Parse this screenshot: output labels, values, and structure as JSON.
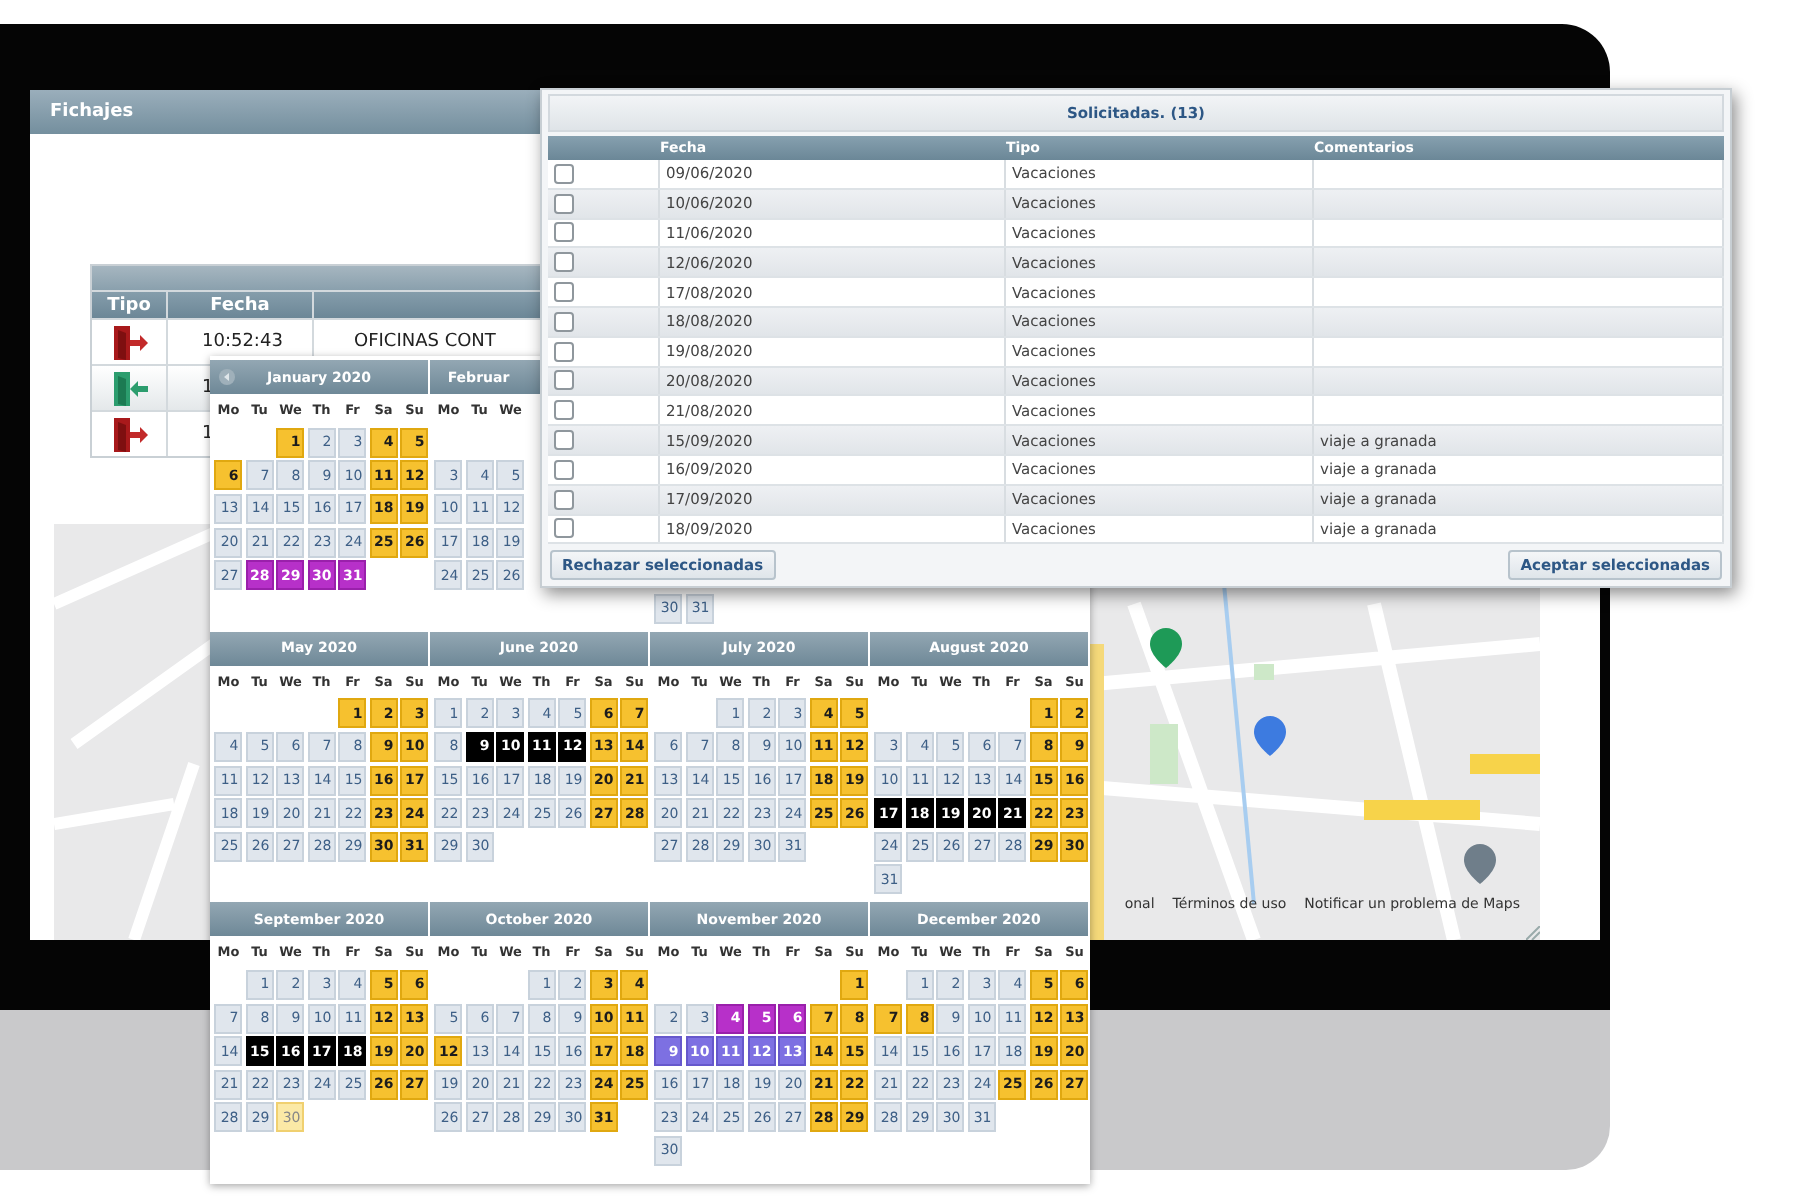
{
  "fichajes": {
    "title": "Fichajes",
    "punches": {
      "columns": [
        "Tipo",
        "Fecha"
      ],
      "rows": [
        {
          "kind": "exit",
          "time": "10:52:43",
          "place": "OFICINAS CONT"
        },
        {
          "kind": "entry",
          "time": "1"
        },
        {
          "kind": "exit",
          "time": "1"
        }
      ]
    },
    "map": {
      "footer": [
        "onal",
        "Términos de uso",
        "Notificar un problema de Maps"
      ]
    }
  },
  "calendar": {
    "rows": [
      {
        "months": [
          {
            "title": "January 2020",
            "nav": true,
            "weekdays": [
              "Mo",
              "Tu",
              "We",
              "Th",
              "Fr",
              "Sa",
              "Su"
            ],
            "weeks": [
              [
                {
                  "kind": "blank"
                },
                {
                  "kind": "blank"
                },
                {
                  "day": "1",
                  "kind": "holiday"
                },
                {
                  "day": "2",
                  "kind": "work"
                },
                {
                  "day": "3",
                  "kind": "work"
                },
                {
                  "day": "4",
                  "kind": "holiday"
                },
                {
                  "day": "5",
                  "kind": "holiday"
                }
              ],
              [
                {
                  "day": "6",
                  "kind": "holiday"
                },
                {
                  "day": "7",
                  "kind": "work"
                },
                {
                  "day": "8",
                  "kind": "work"
                },
                {
                  "day": "9",
                  "kind": "work"
                },
                {
                  "day": "10",
                  "kind": "work"
                },
                {
                  "day": "11",
                  "kind": "holiday"
                },
                {
                  "day": "12",
                  "kind": "holiday"
                }
              ],
              [
                {
                  "day": "13",
                  "kind": "work"
                },
                {
                  "day": "14",
                  "kind": "work"
                },
                {
                  "day": "15",
                  "kind": "work"
                },
                {
                  "day": "16",
                  "kind": "work"
                },
                {
                  "day": "17",
                  "kind": "work"
                },
                {
                  "day": "18",
                  "kind": "holiday"
                },
                {
                  "day": "19",
                  "kind": "holiday"
                }
              ],
              [
                {
                  "day": "20",
                  "kind": "work"
                },
                {
                  "day": "21",
                  "kind": "work"
                },
                {
                  "day": "22",
                  "kind": "work"
                },
                {
                  "day": "23",
                  "kind": "work"
                },
                {
                  "day": "24",
                  "kind": "work"
                },
                {
                  "day": "25",
                  "kind": "holiday"
                },
                {
                  "day": "26",
                  "kind": "holiday"
                }
              ],
              [
                {
                  "day": "27",
                  "kind": "work"
                },
                {
                  "day": "28",
                  "kind": "taken"
                },
                {
                  "day": "29",
                  "kind": "taken"
                },
                {
                  "day": "30",
                  "kind": "taken"
                },
                {
                  "day": "31",
                  "kind": "taken"
                }
              ]
            ]
          },
          {
            "title": "Februar",
            "nav": false,
            "weekdays": [
              "Mo",
              "Tu",
              "We"
            ],
            "weeks": [
              [
                {
                  "kind": "blank"
                }
              ],
              [
                {
                  "day": "3",
                  "kind": "work"
                },
                {
                  "day": "4",
                  "kind": "work"
                },
                {
                  "day": "5",
                  "kind": "work"
                }
              ],
              [
                {
                  "day": "10",
                  "kind": "work"
                },
                {
                  "day": "11",
                  "kind": "work"
                },
                {
                  "day": "12",
                  "kind": "work"
                }
              ],
              [
                {
                  "day": "17",
                  "kind": "work"
                },
                {
                  "day": "18",
                  "kind": "work"
                },
                {
                  "day": "19",
                  "kind": "work"
                }
              ],
              [
                {
                  "day": "24",
                  "kind": "work"
                },
                {
                  "day": "25",
                  "kind": "work"
                },
                {
                  "day": "26",
                  "kind": "work"
                }
              ]
            ]
          },
          {
            "weeks": [
              [
                {
                  "kind": "blank"
                }
              ],
              [
                {
                  "kind": "blank"
                }
              ],
              [
                {
                  "kind": "blank"
                }
              ],
              [
                {
                  "kind": "blank"
                }
              ],
              [
                {
                  "kind": "blank"
                }
              ],
              [
                {
                  "day": "30",
                  "kind": "work"
                },
                {
                  "day": "31",
                  "kind": "work"
                }
              ]
            ]
          }
        ]
      },
      {
        "months": [
          {
            "title": "May 2020",
            "nav": false,
            "weekdays": [
              "Mo",
              "Tu",
              "We",
              "Th",
              "Fr",
              "Sa",
              "Su"
            ],
            "weeks": [
              [
                {
                  "kind": "blank"
                },
                {
                  "kind": "blank"
                },
                {
                  "kind": "blank"
                },
                {
                  "kind": "blank"
                },
                {
                  "day": "1",
                  "kind": "holiday"
                },
                {
                  "day": "2",
                  "kind": "holiday"
                },
                {
                  "day": "3",
                  "kind": "holiday"
                }
              ],
              [
                {
                  "day": "4",
                  "kind": "work"
                },
                {
                  "day": "5",
                  "kind": "work"
                },
                {
                  "day": "6",
                  "kind": "work"
                },
                {
                  "day": "7",
                  "kind": "work"
                },
                {
                  "day": "8",
                  "kind": "work"
                },
                {
                  "day": "9",
                  "kind": "holiday"
                },
                {
                  "day": "10",
                  "kind": "holiday"
                }
              ],
              [
                {
                  "day": "11",
                  "kind": "work"
                },
                {
                  "day": "12",
                  "kind": "work"
                },
                {
                  "day": "13",
                  "kind": "work"
                },
                {
                  "day": "14",
                  "kind": "work"
                },
                {
                  "day": "15",
                  "kind": "work"
                },
                {
                  "day": "16",
                  "kind": "holiday"
                },
                {
                  "day": "17",
                  "kind": "holiday"
                }
              ],
              [
                {
                  "day": "18",
                  "kind": "work"
                },
                {
                  "day": "19",
                  "kind": "work"
                },
                {
                  "day": "20",
                  "kind": "work"
                },
                {
                  "day": "21",
                  "kind": "work"
                },
                {
                  "day": "22",
                  "kind": "work"
                },
                {
                  "day": "23",
                  "kind": "holiday"
                },
                {
                  "day": "24",
                  "kind": "holiday"
                }
              ],
              [
                {
                  "day": "25",
                  "kind": "work"
                },
                {
                  "day": "26",
                  "kind": "work"
                },
                {
                  "day": "27",
                  "kind": "work"
                },
                {
                  "day": "28",
                  "kind": "work"
                },
                {
                  "day": "29",
                  "kind": "work"
                },
                {
                  "day": "30",
                  "kind": "holiday"
                },
                {
                  "day": "31",
                  "kind": "holiday"
                }
              ]
            ]
          },
          {
            "title": "June 2020",
            "nav": false,
            "weekdays": [
              "Mo",
              "Tu",
              "We",
              "Th",
              "Fr",
              "Sa",
              "Su"
            ],
            "weeks": [
              [
                {
                  "day": "1",
                  "kind": "work"
                },
                {
                  "day": "2",
                  "kind": "work"
                },
                {
                  "day": "3",
                  "kind": "work"
                },
                {
                  "day": "4",
                  "kind": "work"
                },
                {
                  "day": "5",
                  "kind": "work"
                },
                {
                  "day": "6",
                  "kind": "holiday"
                },
                {
                  "day": "7",
                  "kind": "holiday"
                }
              ],
              [
                {
                  "day": "8",
                  "kind": "work"
                },
                {
                  "day": "9",
                  "kind": "pending"
                },
                {
                  "day": "10",
                  "kind": "pending"
                },
                {
                  "day": "11",
                  "kind": "pending"
                },
                {
                  "day": "12",
                  "kind": "pending"
                },
                {
                  "day": "13",
                  "kind": "holiday"
                },
                {
                  "day": "14",
                  "kind": "holiday"
                }
              ],
              [
                {
                  "day": "15",
                  "kind": "work"
                },
                {
                  "day": "16",
                  "kind": "work"
                },
                {
                  "day": "17",
                  "kind": "work"
                },
                {
                  "day": "18",
                  "kind": "work"
                },
                {
                  "day": "19",
                  "kind": "work"
                },
                {
                  "day": "20",
                  "kind": "holiday"
                },
                {
                  "day": "21",
                  "kind": "holiday"
                }
              ],
              [
                {
                  "day": "22",
                  "kind": "work"
                },
                {
                  "day": "23",
                  "kind": "work"
                },
                {
                  "day": "24",
                  "kind": "work"
                },
                {
                  "day": "25",
                  "kind": "work"
                },
                {
                  "day": "26",
                  "kind": "work"
                },
                {
                  "day": "27",
                  "kind": "holiday"
                },
                {
                  "day": "28",
                  "kind": "holiday"
                }
              ],
              [
                {
                  "day": "29",
                  "kind": "work"
                },
                {
                  "day": "30",
                  "kind": "work"
                }
              ]
            ]
          },
          {
            "title": "July 2020",
            "nav": false,
            "weekdays": [
              "Mo",
              "Tu",
              "We",
              "Th",
              "Fr",
              "Sa",
              "Su"
            ],
            "weeks": [
              [
                {
                  "kind": "blank"
                },
                {
                  "kind": "blank"
                },
                {
                  "day": "1",
                  "kind": "work"
                },
                {
                  "day": "2",
                  "kind": "work"
                },
                {
                  "day": "3",
                  "kind": "work"
                },
                {
                  "day": "4",
                  "kind": "holiday"
                },
                {
                  "day": "5",
                  "kind": "holiday"
                }
              ],
              [
                {
                  "day": "6",
                  "kind": "work"
                },
                {
                  "day": "7",
                  "kind": "work"
                },
                {
                  "day": "8",
                  "kind": "work"
                },
                {
                  "day": "9",
                  "kind": "work"
                },
                {
                  "day": "10",
                  "kind": "work"
                },
                {
                  "day": "11",
                  "kind": "holiday"
                },
                {
                  "day": "12",
                  "kind": "holiday"
                }
              ],
              [
                {
                  "day": "13",
                  "kind": "work"
                },
                {
                  "day": "14",
                  "kind": "work"
                },
                {
                  "day": "15",
                  "kind": "work"
                },
                {
                  "day": "16",
                  "kind": "work"
                },
                {
                  "day": "17",
                  "kind": "work"
                },
                {
                  "day": "18",
                  "kind": "holiday"
                },
                {
                  "day": "19",
                  "kind": "holiday"
                }
              ],
              [
                {
                  "day": "20",
                  "kind": "work"
                },
                {
                  "day": "21",
                  "kind": "work"
                },
                {
                  "day": "22",
                  "kind": "work"
                },
                {
                  "day": "23",
                  "kind": "work"
                },
                {
                  "day": "24",
                  "kind": "work"
                },
                {
                  "day": "25",
                  "kind": "holiday"
                },
                {
                  "day": "26",
                  "kind": "holiday"
                }
              ],
              [
                {
                  "day": "27",
                  "kind": "work"
                },
                {
                  "day": "28",
                  "kind": "work"
                },
                {
                  "day": "29",
                  "kind": "work"
                },
                {
                  "day": "30",
                  "kind": "work"
                },
                {
                  "day": "31",
                  "kind": "work"
                }
              ]
            ]
          },
          {
            "title": "August 2020",
            "nav": false,
            "weekdays": [
              "Mo",
              "Tu",
              "We",
              "Th",
              "Fr",
              "Sa",
              "Su"
            ],
            "weeks": [
              [
                {
                  "kind": "blank"
                },
                {
                  "kind": "blank"
                },
                {
                  "kind": "blank"
                },
                {
                  "kind": "blank"
                },
                {
                  "kind": "blank"
                },
                {
                  "day": "1",
                  "kind": "holiday"
                },
                {
                  "day": "2",
                  "kind": "holiday"
                }
              ],
              [
                {
                  "day": "3",
                  "kind": "work"
                },
                {
                  "day": "4",
                  "kind": "work"
                },
                {
                  "day": "5",
                  "kind": "work"
                },
                {
                  "day": "6",
                  "kind": "work"
                },
                {
                  "day": "7",
                  "kind": "work"
                },
                {
                  "day": "8",
                  "kind": "holiday"
                },
                {
                  "day": "9",
                  "kind": "holiday"
                }
              ],
              [
                {
                  "day": "10",
                  "kind": "work"
                },
                {
                  "day": "11",
                  "kind": "work"
                },
                {
                  "day": "12",
                  "kind": "work"
                },
                {
                  "day": "13",
                  "kind": "work"
                },
                {
                  "day": "14",
                  "kind": "work"
                },
                {
                  "day": "15",
                  "kind": "holiday"
                },
                {
                  "day": "16",
                  "kind": "holiday"
                }
              ],
              [
                {
                  "day": "17",
                  "kind": "pending"
                },
                {
                  "day": "18",
                  "kind": "pending"
                },
                {
                  "day": "19",
                  "kind": "pending"
                },
                {
                  "day": "20",
                  "kind": "pending"
                },
                {
                  "day": "21",
                  "kind": "pending"
                },
                {
                  "day": "22",
                  "kind": "holiday"
                },
                {
                  "day": "23",
                  "kind": "holiday"
                }
              ],
              [
                {
                  "day": "24",
                  "kind": "work"
                },
                {
                  "day": "25",
                  "kind": "work"
                },
                {
                  "day": "26",
                  "kind": "work"
                },
                {
                  "day": "27",
                  "kind": "work"
                },
                {
                  "day": "28",
                  "kind": "work"
                },
                {
                  "day": "29",
                  "kind": "holiday"
                },
                {
                  "day": "30",
                  "kind": "holiday"
                }
              ],
              [
                {
                  "day": "31",
                  "kind": "work"
                }
              ]
            ]
          }
        ]
      },
      {
        "months": [
          {
            "title": "September 2020",
            "nav": false,
            "weekdays": [
              "Mo",
              "Tu",
              "We",
              "Th",
              "Fr",
              "Sa",
              "Su"
            ],
            "weeks": [
              [
                {
                  "kind": "blank"
                },
                {
                  "day": "1",
                  "kind": "work"
                },
                {
                  "day": "2",
                  "kind": "work"
                },
                {
                  "day": "3",
                  "kind": "work"
                },
                {
                  "day": "4",
                  "kind": "work"
                },
                {
                  "day": "5",
                  "kind": "holiday"
                },
                {
                  "day": "6",
                  "kind": "holiday"
                }
              ],
              [
                {
                  "day": "7",
                  "kind": "work"
                },
                {
                  "day": "8",
                  "kind": "work"
                },
                {
                  "day": "9",
                  "kind": "work"
                },
                {
                  "day": "10",
                  "kind": "work"
                },
                {
                  "day": "11",
                  "kind": "work"
                },
                {
                  "day": "12",
                  "kind": "holiday"
                },
                {
                  "day": "13",
                  "kind": "holiday"
                }
              ],
              [
                {
                  "day": "14",
                  "kind": "work"
                },
                {
                  "day": "15",
                  "kind": "pending"
                },
                {
                  "day": "16",
                  "kind": "pending"
                },
                {
                  "day": "17",
                  "kind": "pending"
                },
                {
                  "day": "18",
                  "kind": "pending"
                },
                {
                  "day": "19",
                  "kind": "holiday"
                },
                {
                  "day": "20",
                  "kind": "holiday"
                }
              ],
              [
                {
                  "day": "21",
                  "kind": "work"
                },
                {
                  "day": "22",
                  "kind": "work"
                },
                {
                  "day": "23",
                  "kind": "work"
                },
                {
                  "day": "24",
                  "kind": "work"
                },
                {
                  "day": "25",
                  "kind": "work"
                },
                {
                  "day": "26",
                  "kind": "holiday"
                },
                {
                  "day": "27",
                  "kind": "holiday"
                }
              ],
              [
                {
                  "day": "28",
                  "kind": "work"
                },
                {
                  "day": "29",
                  "kind": "work"
                },
                {
                  "day": "30",
                  "kind": "today"
                }
              ]
            ]
          },
          {
            "title": "October 2020",
            "nav": false,
            "weekdays": [
              "Mo",
              "Tu",
              "We",
              "Th",
              "Fr",
              "Sa",
              "Su"
            ],
            "weeks": [
              [
                {
                  "kind": "blank"
                },
                {
                  "kind": "blank"
                },
                {
                  "kind": "blank"
                },
                {
                  "day": "1",
                  "kind": "work"
                },
                {
                  "day": "2",
                  "kind": "work"
                },
                {
                  "day": "3",
                  "kind": "holiday"
                },
                {
                  "day": "4",
                  "kind": "holiday"
                }
              ],
              [
                {
                  "day": "5",
                  "kind": "work"
                },
                {
                  "day": "6",
                  "kind": "work"
                },
                {
                  "day": "7",
                  "kind": "work"
                },
                {
                  "day": "8",
                  "kind": "work"
                },
                {
                  "day": "9",
                  "kind": "work"
                },
                {
                  "day": "10",
                  "kind": "holiday"
                },
                {
                  "day": "11",
                  "kind": "holiday"
                }
              ],
              [
                {
                  "day": "12",
                  "kind": "holiday"
                },
                {
                  "day": "13",
                  "kind": "work"
                },
                {
                  "day": "14",
                  "kind": "work"
                },
                {
                  "day": "15",
                  "kind": "work"
                },
                {
                  "day": "16",
                  "kind": "work"
                },
                {
                  "day": "17",
                  "kind": "holiday"
                },
                {
                  "day": "18",
                  "kind": "holiday"
                }
              ],
              [
                {
                  "day": "19",
                  "kind": "work"
                },
                {
                  "day": "20",
                  "kind": "work"
                },
                {
                  "day": "21",
                  "kind": "work"
                },
                {
                  "day": "22",
                  "kind": "work"
                },
                {
                  "day": "23",
                  "kind": "work"
                },
                {
                  "day": "24",
                  "kind": "holiday"
                },
                {
                  "day": "25",
                  "kind": "holiday"
                }
              ],
              [
                {
                  "day": "26",
                  "kind": "work"
                },
                {
                  "day": "27",
                  "kind": "work"
                },
                {
                  "day": "28",
                  "kind": "work"
                },
                {
                  "day": "29",
                  "kind": "work"
                },
                {
                  "day": "30",
                  "kind": "work"
                },
                {
                  "day": "31",
                  "kind": "holiday"
                }
              ]
            ]
          },
          {
            "title": "November 2020",
            "nav": false,
            "weekdays": [
              "Mo",
              "Tu",
              "We",
              "Th",
              "Fr",
              "Sa",
              "Su"
            ],
            "weeks": [
              [
                {
                  "kind": "blank"
                },
                {
                  "kind": "blank"
                },
                {
                  "kind": "blank"
                },
                {
                  "kind": "blank"
                },
                {
                  "kind": "blank"
                },
                {
                  "kind": "blank"
                },
                {
                  "day": "1",
                  "kind": "holiday"
                }
              ],
              [
                {
                  "day": "2",
                  "kind": "work"
                },
                {
                  "day": "3",
                  "kind": "work"
                },
                {
                  "day": "4",
                  "kind": "taken"
                },
                {
                  "day": "5",
                  "kind": "taken"
                },
                {
                  "day": "6",
                  "kind": "taken"
                },
                {
                  "day": "7",
                  "kind": "holiday"
                },
                {
                  "day": "8",
                  "kind": "holiday"
                }
              ],
              [
                {
                  "day": "9",
                  "kind": "approved"
                },
                {
                  "day": "10",
                  "kind": "approved"
                },
                {
                  "day": "11",
                  "kind": "approved"
                },
                {
                  "day": "12",
                  "kind": "approved"
                },
                {
                  "day": "13",
                  "kind": "approved"
                },
                {
                  "day": "14",
                  "kind": "holiday"
                },
                {
                  "day": "15",
                  "kind": "holiday"
                }
              ],
              [
                {
                  "day": "16",
                  "kind": "work"
                },
                {
                  "day": "17",
                  "kind": "work"
                },
                {
                  "day": "18",
                  "kind": "work"
                },
                {
                  "day": "19",
                  "kind": "work"
                },
                {
                  "day": "20",
                  "kind": "work"
                },
                {
                  "day": "21",
                  "kind": "holiday"
                },
                {
                  "day": "22",
                  "kind": "holiday"
                }
              ],
              [
                {
                  "day": "23",
                  "kind": "work"
                },
                {
                  "day": "24",
                  "kind": "work"
                },
                {
                  "day": "25",
                  "kind": "work"
                },
                {
                  "day": "26",
                  "kind": "work"
                },
                {
                  "day": "27",
                  "kind": "work"
                },
                {
                  "day": "28",
                  "kind": "holiday"
                },
                {
                  "day": "29",
                  "kind": "holiday"
                }
              ],
              [
                {
                  "day": "30",
                  "kind": "work"
                }
              ]
            ]
          },
          {
            "title": "December 2020",
            "nav": false,
            "weekdays": [
              "Mo",
              "Tu",
              "We",
              "Th",
              "Fr",
              "Sa",
              "Su"
            ],
            "weeks": [
              [
                {
                  "kind": "blank"
                },
                {
                  "day": "1",
                  "kind": "work"
                },
                {
                  "day": "2",
                  "kind": "work"
                },
                {
                  "day": "3",
                  "kind": "work"
                },
                {
                  "day": "4",
                  "kind": "work"
                },
                {
                  "day": "5",
                  "kind": "holiday"
                },
                {
                  "day": "6",
                  "kind": "holiday"
                }
              ],
              [
                {
                  "day": "7",
                  "kind": "holiday"
                },
                {
                  "day": "8",
                  "kind": "holiday"
                },
                {
                  "day": "9",
                  "kind": "work"
                },
                {
                  "day": "10",
                  "kind": "work"
                },
                {
                  "day": "11",
                  "kind": "work"
                },
                {
                  "day": "12",
                  "kind": "holiday"
                },
                {
                  "day": "13",
                  "kind": "holiday"
                }
              ],
              [
                {
                  "day": "14",
                  "kind": "work"
                },
                {
                  "day": "15",
                  "kind": "work"
                },
                {
                  "day": "16",
                  "kind": "work"
                },
                {
                  "day": "17",
                  "kind": "work"
                },
                {
                  "day": "18",
                  "kind": "work"
                },
                {
                  "day": "19",
                  "kind": "holiday"
                },
                {
                  "day": "20",
                  "kind": "holiday"
                }
              ],
              [
                {
                  "day": "21",
                  "kind": "work"
                },
                {
                  "day": "22",
                  "kind": "work"
                },
                {
                  "day": "23",
                  "kind": "work"
                },
                {
                  "day": "24",
                  "kind": "work"
                },
                {
                  "day": "25",
                  "kind": "holiday"
                },
                {
                  "day": "26",
                  "kind": "holiday"
                },
                {
                  "day": "27",
                  "kind": "holiday"
                }
              ],
              [
                {
                  "day": "28",
                  "kind": "work"
                },
                {
                  "day": "29",
                  "kind": "work"
                },
                {
                  "day": "30",
                  "kind": "work"
                },
                {
                  "day": "31",
                  "kind": "work"
                }
              ]
            ]
          }
        ]
      }
    ]
  },
  "requests": {
    "title": "Solicitadas. (13)",
    "columns": [
      "Fecha",
      "Tipo",
      "Comentarios"
    ],
    "rows": [
      {
        "checked": false,
        "date": "09/06/2020",
        "type": "Vacaciones"
      },
      {
        "checked": false,
        "date": "10/06/2020",
        "type": "Vacaciones"
      },
      {
        "checked": false,
        "date": "11/06/2020",
        "type": "Vacaciones"
      },
      {
        "checked": false,
        "date": "12/06/2020",
        "type": "Vacaciones"
      },
      {
        "checked": false,
        "date": "17/08/2020",
        "type": "Vacaciones"
      },
      {
        "checked": false,
        "date": "18/08/2020",
        "type": "Vacaciones"
      },
      {
        "checked": false,
        "date": "19/08/2020",
        "type": "Vacaciones"
      },
      {
        "checked": false,
        "date": "20/08/2020",
        "type": "Vacaciones"
      },
      {
        "checked": false,
        "date": "21/08/2020",
        "type": "Vacaciones"
      },
      {
        "checked": false,
        "date": "15/09/2020",
        "type": "Vacaciones",
        "comment": "viaje a granada"
      },
      {
        "checked": false,
        "date": "16/09/2020",
        "type": "Vacaciones",
        "comment": "viaje a granada"
      },
      {
        "checked": false,
        "date": "17/09/2020",
        "type": "Vacaciones",
        "comment": "viaje a granada"
      },
      {
        "checked": false,
        "date": "18/09/2020",
        "type": "Vacaciones",
        "comment": "viaje a granada"
      }
    ],
    "reject_button": "Rechazar seleccionadas",
    "accept_button": "Aceptar seleccionadas"
  }
}
